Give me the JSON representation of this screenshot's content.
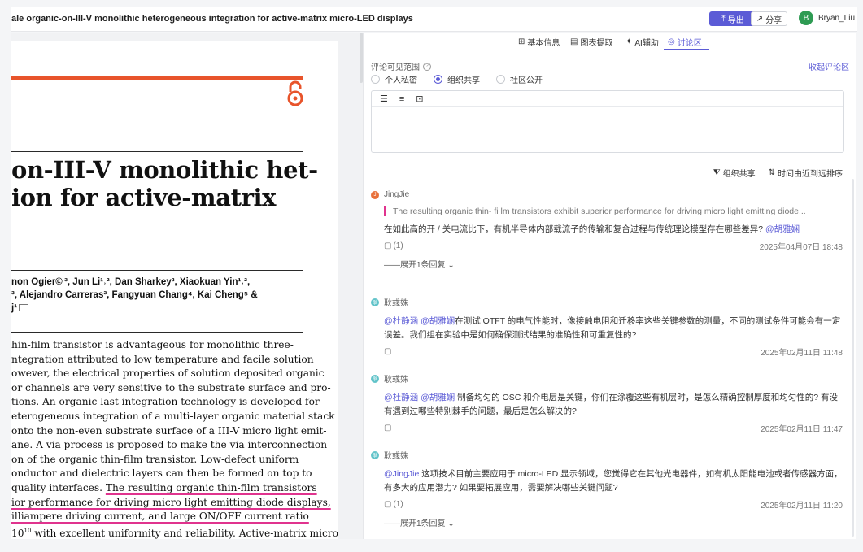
{
  "header": {
    "title": "ale organic-on-III-V monolithic heterogeneous integration for active-matrix micro-LED displays",
    "export_label": "导出",
    "share_label": "分享",
    "user_initial": "B",
    "user_name": "Bryan_Liu"
  },
  "pdf": {
    "title_lines": [
      "on-III-V monolithic het-",
      "ion for active-matrix"
    ],
    "author_lines": [
      "non Ogier© ³, Jun Li¹˒², Dan Sharkey³, Xiaokuan Yin¹˒²,",
      "³, Alejandro Carreras³, Fangyuan Chang⁴, Kai Cheng⁵ &",
      "j¹"
    ],
    "abstract_lines": [
      "hin-film transistor is advantageous for monolithic three-",
      "ntegration attributed to low temperature and facile solution",
      "owever, the electrical properties of solution deposited organic",
      "or channels are very sensitive to the substrate surface and pro-",
      "tions. An organic-last integration technology is developed for",
      "eterogeneous integration of a multi-layer organic material stack",
      "onto the non-even substrate surface of a III-V micro light emit-",
      "ane. A via process is proposed to make the via interconnection",
      "on of the organic thin-film transistor. Low-defect uniform",
      "onductor and dielectric layers can then be formed on top to",
      "quality interfaces."
    ],
    "abstract_hl_1": "The resulting organic thin-film transistors",
    "abstract_hl_2": "ior performance for driving micro light emitting diode displays,",
    "abstract_hl_3": "illiampere driving current, and large ON/OFF current ratio",
    "abstract_hl_4a": "10",
    "abstract_hl_4b": "10",
    "abstract_hl_4c": " with excellent uniformity and reliability.",
    "abstract_tail": " Active-matrix micro"
  },
  "tabs": [
    {
      "label": "基本信息",
      "icon": "grid-icon"
    },
    {
      "label": "图表提取",
      "icon": "chart-icon"
    },
    {
      "label": "AI辅助",
      "icon": "sparkle-icon"
    },
    {
      "label": "讨论区",
      "icon": "chat-icon"
    }
  ],
  "discussion": {
    "visibility_label": "评论可见范围",
    "collapse_label": "收起评论区",
    "options": [
      "个人私密",
      "组织共享",
      "社区公开"
    ],
    "selected_option": "组织共享",
    "filter_scope": "组织共享",
    "filter_sort": "时间由近到远排序"
  },
  "comments": [
    {
      "author": "JingJie",
      "avatar_initial": "J",
      "quote": "The resulting organic thin- fi lm transistors exhibit superior performance for driving micro light emitting diode...",
      "body_text": "在如此高的开 / 关电流比下，有机半导体内部载流子的传输和复合过程与传统理论模型存在哪些差异?",
      "mentions_after": "@胡雅娴",
      "reply_count": "(1)",
      "time": "2025年04月07日 18:48",
      "expand": "——展开1条回复"
    },
    {
      "author": "耿彧姝",
      "avatar_initial": "耿",
      "mentions_before": "@杜静涵 @胡雅娴",
      "body_text": "在测试 OTFT 的电气性能时，像接触电阻和迁移率这些关键参数的测量，不同的测试条件可能会有一定误差。我们组在实验中是如何确保测试结果的准确性和可重复性的?",
      "time": "2025年02月11日 11:48"
    },
    {
      "author": "耿彧姝",
      "avatar_initial": "耿",
      "mentions_before": "@杜静涵 @胡雅娴",
      "body_text": " 制备均匀的 OSC 和介电层是关键，你们在涂覆这些有机层时，是怎么精确控制厚度和均匀性的? 有没有遇到过哪些特别棘手的问题，最后是怎么解决的?",
      "time": "2025年02月11日 11:47"
    },
    {
      "author": "耿彧姝",
      "avatar_initial": "耿",
      "mentions_before": "@JingJie",
      "body_text": "  这项技术目前主要应用于 micro-LED 显示领域，您觉得它在其他光电器件，如有机太阳能电池或者传感器方面，有多大的应用潜力? 如果要拓展应用，需要解决哪些关键问题?",
      "reply_count": "(1)",
      "time": "2025年02月11日 11:20",
      "expand": "——展开1条回复"
    }
  ]
}
